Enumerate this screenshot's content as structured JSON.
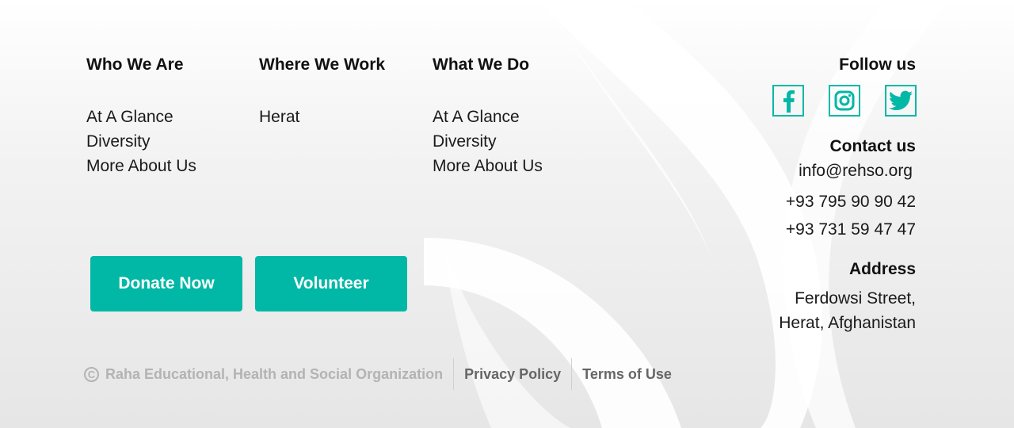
{
  "nav": {
    "col1": {
      "title": "Who We Are",
      "links": [
        "At A Glance",
        "Diversity",
        "More About Us"
      ]
    },
    "col2": {
      "title": "Where We Work",
      "links": [
        "Herat"
      ]
    },
    "col3": {
      "title": "What We Do",
      "links": [
        "At A Glance",
        "Diversity",
        "More About Us"
      ]
    }
  },
  "buttons": {
    "donate": "Donate Now",
    "volunteer": "Volunteer"
  },
  "footer": {
    "copyright_symbol": "C",
    "org": "Raha Educational, Health and Social Organization",
    "privacy": "Privacy Policy",
    "terms": "Terms of Use"
  },
  "sidebar": {
    "follow_title": "Follow us",
    "social_icons": [
      "facebook-icon",
      "instagram-icon",
      "twitter-icon"
    ],
    "contact_title": "Contact us",
    "email": "info@rehso.org",
    "phone1": "+93 795 90 90 42",
    "phone2": "+93 731 59 47 47",
    "address_title": "Address",
    "address_line1": "Ferdowsi Street,",
    "address_line2": "Herat, Afghanistan"
  },
  "colors": {
    "accent": "#00b8a5"
  }
}
